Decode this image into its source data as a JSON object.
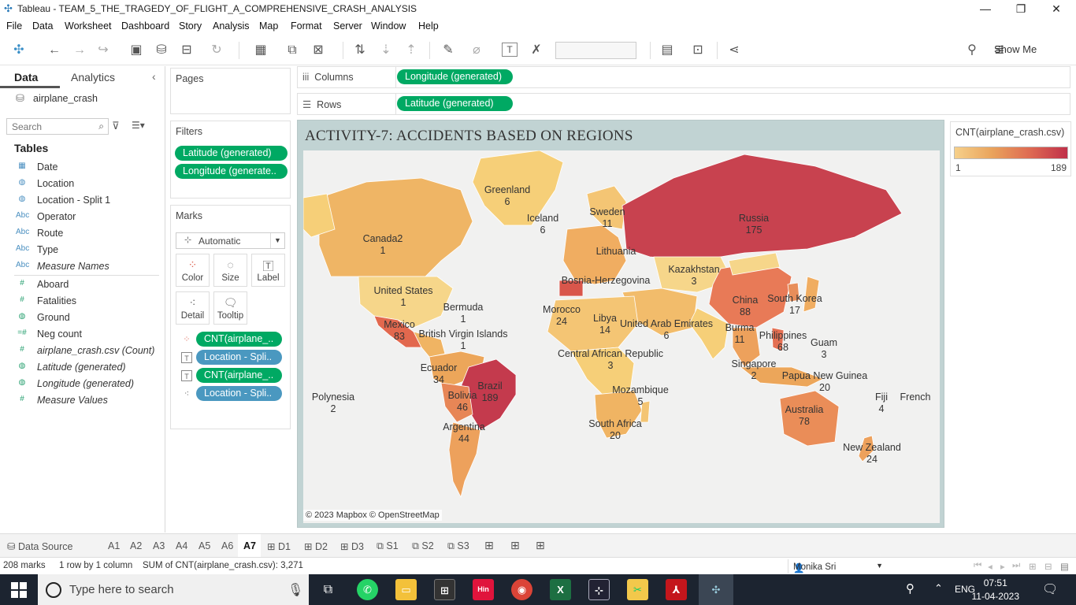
{
  "window": {
    "title": "Tableau - TEAM_5_THE_TRAGEDY_OF_FLIGHT_A_COMPREHENSIVE_CRASH_ANALYSIS"
  },
  "menu": [
    "File",
    "Data",
    "Worksheet",
    "Dashboard",
    "Story",
    "Analysis",
    "Map",
    "Format",
    "Server",
    "Window",
    "Help"
  ],
  "toolbar": {
    "show_me": "Show Me"
  },
  "data_pane": {
    "tab_data": "Data",
    "tab_analytics": "Analytics",
    "datasource": "airplane_crash",
    "search_placeholder": "Search",
    "tables_heading": "Tables",
    "fields": [
      {
        "type": "Date",
        "icon": "calendar-icon",
        "label": "Date"
      },
      {
        "type": "geo",
        "icon": "globe-icon",
        "label": "Location"
      },
      {
        "type": "geo",
        "icon": "globe-icon",
        "label": "Location - Split 1"
      },
      {
        "type": "Abc",
        "icon": "abc-icon",
        "label": "Operator"
      },
      {
        "type": "Abc",
        "icon": "abc-icon",
        "label": "Route"
      },
      {
        "type": "Abc",
        "icon": "abc-icon",
        "label": "Type"
      },
      {
        "type": "Abc",
        "icon": "abc-icon",
        "label": "Measure Names"
      },
      {
        "type": "#",
        "icon": "number-icon",
        "label": "Aboard"
      },
      {
        "type": "#",
        "icon": "number-icon",
        "label": "Fatalities"
      },
      {
        "type": "geo",
        "icon": "globe-icon",
        "label": "Ground"
      },
      {
        "type": "=#",
        "icon": "calc-number-icon",
        "label": "Neg count"
      },
      {
        "type": "=#",
        "icon": "number-icon",
        "label": "airplane_crash.csv (Count)"
      },
      {
        "type": "geo",
        "icon": "globe-icon",
        "label": "Latitude (generated)"
      },
      {
        "type": "geo",
        "icon": "globe-icon",
        "label": "Longitude (generated)"
      },
      {
        "type": "#",
        "icon": "number-icon",
        "label": "Measure Values"
      }
    ]
  },
  "pages": {
    "heading": "Pages"
  },
  "filters": {
    "heading": "Filters",
    "pills": [
      "Latitude (generated)",
      "Longitude (generate.."
    ]
  },
  "marks": {
    "heading": "Marks",
    "type": "Automatic",
    "buttons": {
      "color": "Color",
      "size": "Size",
      "label": "Label",
      "detail": "Detail",
      "tooltip": "Tooltip"
    },
    "pills": [
      "CNT(airplane_..",
      "Location - Spli..",
      "CNT(airplane_..",
      "Location - Spli.."
    ]
  },
  "columns": {
    "heading": "Columns",
    "pill": "Longitude (generated)"
  },
  "rows": {
    "heading": "Rows",
    "pill": "Latitude (generated)"
  },
  "view": {
    "title": "ACTIVITY-7: ACCIDENTS BASED ON REGIONS",
    "attribution": "© 2023 Mapbox © OpenStreetMap"
  },
  "map_labels": [
    {
      "name": "Greenland",
      "value": "6"
    },
    {
      "name": "Iceland",
      "value": "6"
    },
    {
      "name": "Sweden",
      "value": "11"
    },
    {
      "name": "Russia",
      "value": "175"
    },
    {
      "name": "Canada2",
      "value": "1"
    },
    {
      "name": "Lithuania",
      "value": ""
    },
    {
      "name": "Kazakhstan",
      "value": "3"
    },
    {
      "name": "Bosnia-Herzegovina",
      "value": ""
    },
    {
      "name": "United States",
      "value": "1"
    },
    {
      "name": "Bermuda",
      "value": "1"
    },
    {
      "name": "China",
      "value": "88"
    },
    {
      "name": "South Korea",
      "value": "17"
    },
    {
      "name": "Morocco",
      "value": "24"
    },
    {
      "name": "Libya",
      "value": "14"
    },
    {
      "name": "United Arab Emirates",
      "value": "6"
    },
    {
      "name": "Mexico",
      "value": "83"
    },
    {
      "name": "British Virgin Islands",
      "value": "1"
    },
    {
      "name": "Burma",
      "value": "11"
    },
    {
      "name": "Philippines",
      "value": "68"
    },
    {
      "name": "Guam",
      "value": "3"
    },
    {
      "name": "Central African Republic",
      "value": "3"
    },
    {
      "name": "Ecuador",
      "value": "34"
    },
    {
      "name": "Singapore",
      "value": "2"
    },
    {
      "name": "Papua New Guinea",
      "value": "20"
    },
    {
      "name": "Brazil",
      "value": "189"
    },
    {
      "name": "Mozambique",
      "value": "5"
    },
    {
      "name": "Polynesia",
      "value": "2"
    },
    {
      "name": "Bolivia",
      "value": "46"
    },
    {
      "name": "Fiji",
      "value": "4"
    },
    {
      "name": "French",
      "value": ""
    },
    {
      "name": "Australia",
      "value": "78"
    },
    {
      "name": "Argentina",
      "value": "44"
    },
    {
      "name": "South Africa",
      "value": "20"
    },
    {
      "name": "New Zealand",
      "value": "24"
    }
  ],
  "legend": {
    "heading": "CNT(airplane_crash.csv)",
    "min": "1",
    "max": "189",
    "colors": [
      "#f6d08a",
      "#e9a35c",
      "#de6a52",
      "#c0304a"
    ]
  },
  "sheet_tabs": {
    "data_source": "Data Source",
    "tabs": [
      "A1",
      "A2",
      "A3",
      "A4",
      "A5",
      "A6",
      "A7",
      "D1",
      "D2",
      "D3",
      "S1",
      "S2",
      "S3"
    ],
    "active": "A7"
  },
  "status": {
    "marks": "208 marks",
    "dims": "1 row by 1 column",
    "sum": "SUM of CNT(airplane_crash.csv): 3,271",
    "user": "Monika Sri"
  },
  "taskbar": {
    "search_placeholder": "Type here to search",
    "lang": "ENG",
    "time": "07:51",
    "date": "11-04-2023"
  }
}
